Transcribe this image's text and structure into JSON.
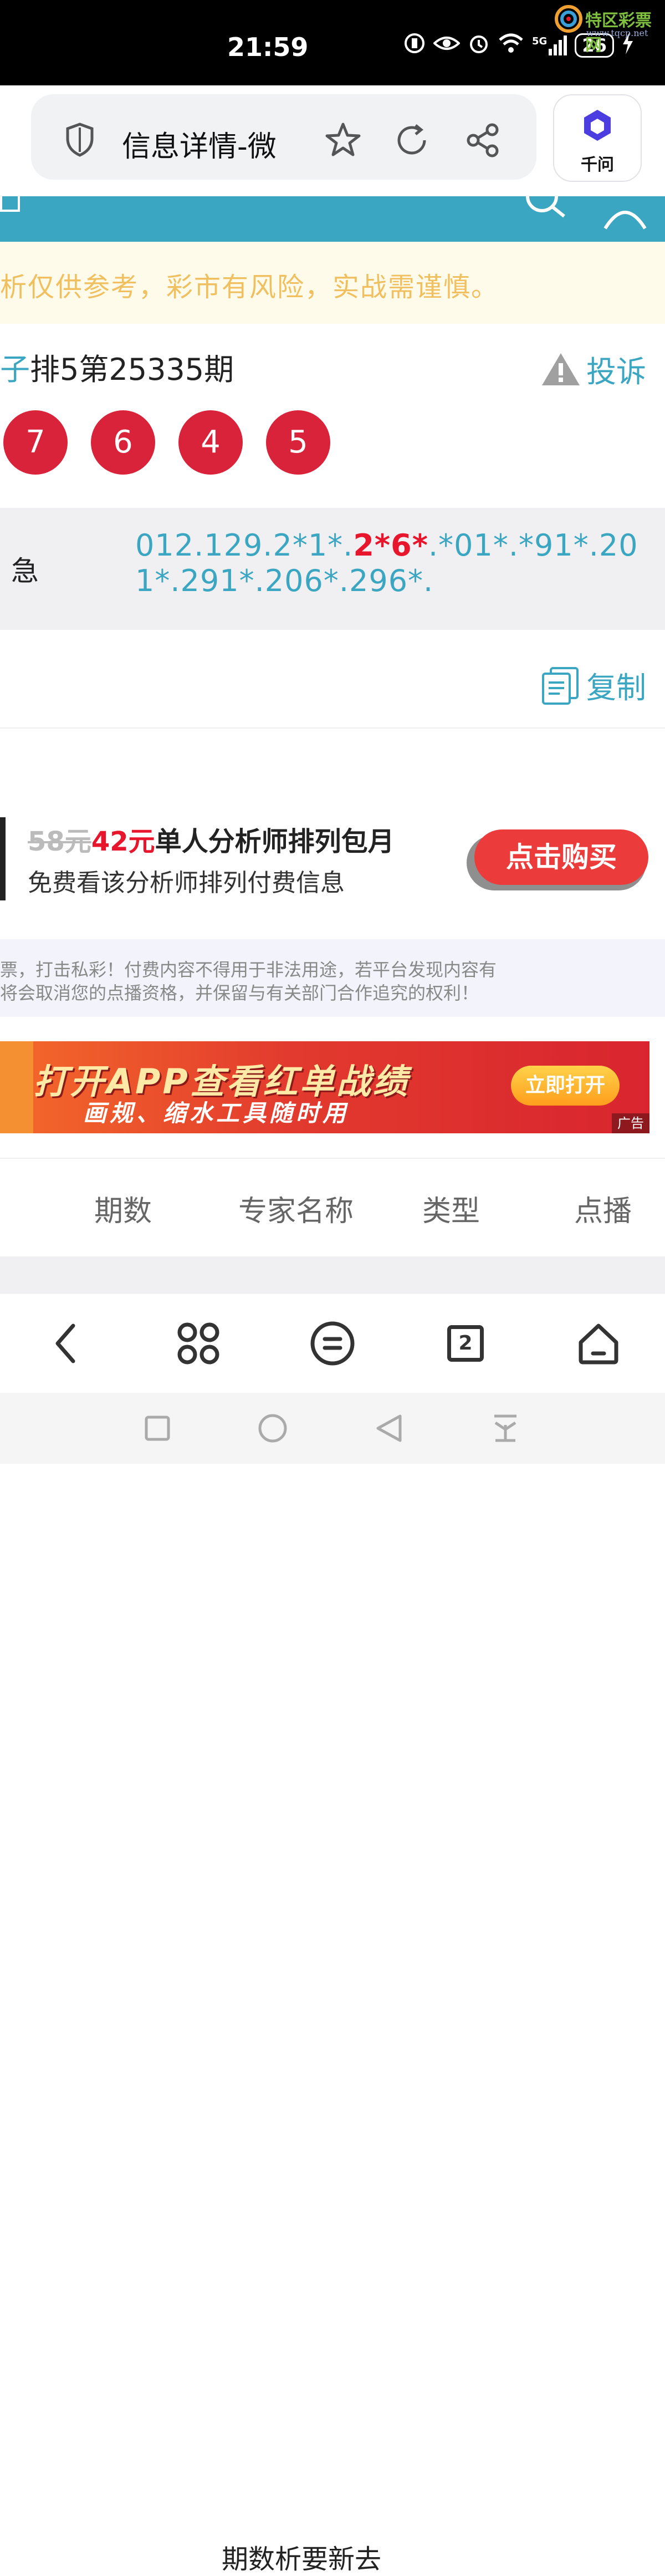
{
  "status_bar": {
    "time": "21:59",
    "network": "5G",
    "battery": "26",
    "icons": [
      "hd-call-icon",
      "eye-icon",
      "alarm-icon",
      "wifi-icon",
      "signal-icon",
      "battery-icon",
      "charging-icon"
    ]
  },
  "watermark": {
    "text": "特区彩票网",
    "url": "www.tqcp.net"
  },
  "browser": {
    "page_title": "信息详情-微",
    "assistant_label": "千问",
    "icons": [
      "shield-icon",
      "star-icon",
      "reload-icon",
      "share-icon"
    ]
  },
  "notice": {
    "text": "析仅供参考，彩市有风险，实战需谨慎。"
  },
  "issue": {
    "title_prefix": "子",
    "title": "排5第25335期",
    "complaint_label": "投诉",
    "balls": [
      "7",
      "6",
      "4",
      "5"
    ]
  },
  "code": {
    "label": "急",
    "part1": "012.129.2*1*.",
    "highlight": "2*6*",
    "part2": ".*01*.*91*.201*.291*.206*.296*."
  },
  "copy_label": "复制",
  "promo": {
    "price_old": "58元",
    "price_new": "42元",
    "description": "单人分析师排列包月",
    "subtitle": "免费看该分析师排列付费信息",
    "buy_label": "点击购买"
  },
  "disclaimer": {
    "line1": "票，打击私彩！付费内容不得用于非法用途，若平台发现内容有",
    "line2": "将会取消您的点播资格，并保留与有关部门合作追究的权利！"
  },
  "banner": {
    "main": "打开APP查看红单战绩",
    "sub": "画规、缩水工具随时用",
    "open_label": "立即打开",
    "ad_tag": "广告"
  },
  "table": {
    "headers": [
      "期数",
      "专家名称",
      "类型",
      "点播"
    ],
    "partial_row": "期数析要新去"
  },
  "bottom_nav": {
    "tab_count": "2",
    "items": [
      "back-icon",
      "apps-icon",
      "menu-icon",
      "tabs-icon",
      "home-icon"
    ]
  },
  "colors": {
    "accent": "#3ba6c1",
    "red": "#d9233a",
    "notice_text": "#f0c060"
  }
}
